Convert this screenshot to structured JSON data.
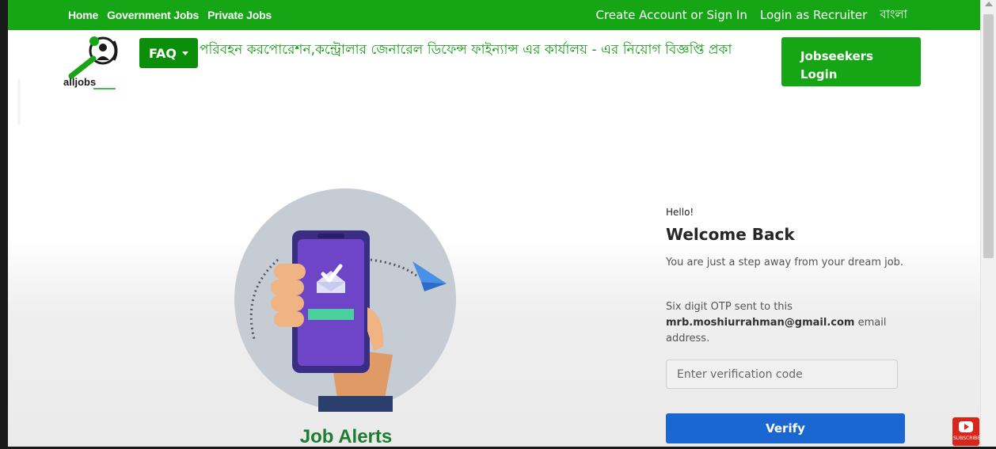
{
  "nav": {
    "left_links": [
      {
        "label": "Home"
      },
      {
        "label": "Government Jobs"
      },
      {
        "label": "Private Jobs"
      }
    ],
    "right_links": [
      {
        "label": "Create Account or Sign In"
      },
      {
        "label": "Login as Recruiter"
      },
      {
        "label": "বাংলা"
      }
    ]
  },
  "header": {
    "logo_text": "alljobs",
    "faq_label": "FAQ",
    "ticker_text": "পরিবহন করপোরেশন,কন্ট্রোলার জেনারেল ডিফেন্স ফাইন্যান্স এর কার্যালয় - এর নিয়োগ বিজ্ঞপ্তি প্রকা",
    "jobseekers_label_line1": "Jobseekers",
    "jobseekers_label_line2": "Login"
  },
  "illustration": {
    "title": "Job Alerts"
  },
  "login": {
    "hello": "Hello!",
    "welcome": "Welcome Back",
    "subtitle": "You are just a step away from your dream job.",
    "otp_prefix": "Six digit OTP sent to this",
    "email": "mrb.moshiurrahman@gmail.com",
    "otp_suffix": "email address.",
    "code_placeholder": "Enter verification code",
    "verify_label": "Verify"
  },
  "youtube": {
    "label": "SUBSCRIBE"
  },
  "colors": {
    "brand_green": "#15a515",
    "verify_blue": "#1a67d2",
    "illus_title_green": "#1c7d2f"
  }
}
